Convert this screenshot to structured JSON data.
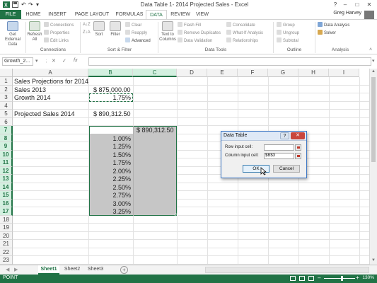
{
  "titlebar": {
    "title": "Data Table 1- 2014 Projected Sales - Excel",
    "help": "?",
    "minimize": "–",
    "restore": "□",
    "close": "✕"
  },
  "tabs": [
    "FILE",
    "HOME",
    "INSERT",
    "PAGE LAYOUT",
    "FORMULAS",
    "DATA",
    "REVIEW",
    "VIEW"
  ],
  "active_tab": "DATA",
  "user": "Greg Harvey",
  "ribbon": {
    "get_external": "Get External Data",
    "refresh_all": "Refresh All",
    "connections": "Connections",
    "properties": "Properties",
    "edit_links": "Edit Links",
    "sort": "Sort",
    "filter": "Filter",
    "clear": "Clear",
    "reapply": "Reapply",
    "advanced": "Advanced",
    "text_to_columns": "Text to Columns",
    "flash_fill": "Flash Fill",
    "remove_duplicates": "Remove Duplicates",
    "data_validation": "Data Validation",
    "consolidate": "Consolidate",
    "what_if": "What-If Analysis",
    "relationships": "Relationships",
    "group": "Group",
    "ungroup": "Ungroup",
    "subtotal": "Subtotal",
    "data_analysis": "Data Analysis",
    "solver": "Solver",
    "groups": [
      "Connections",
      "Sort & Filter",
      "Data Tools",
      "Outline",
      "Analysis"
    ]
  },
  "formula_bar": {
    "name_box": "Growth_2...",
    "cancel": "✕",
    "enter": "✓",
    "fx": "fx",
    "value": ""
  },
  "columns": [
    "A",
    "B",
    "C",
    "D",
    "E",
    "F",
    "G",
    "H",
    "I"
  ],
  "selected_columns": [
    "B",
    "C"
  ],
  "rows": [
    "1",
    "2",
    "3",
    "4",
    "5",
    "6",
    "7",
    "8",
    "9",
    "10",
    "11",
    "12",
    "13",
    "14",
    "15",
    "16",
    "17",
    "18",
    "19",
    "20",
    "21",
    "22",
    "23"
  ],
  "selected_rows": [
    "7",
    "8",
    "9",
    "10",
    "11",
    "12",
    "13",
    "14",
    "15",
    "16",
    "17"
  ],
  "cells": {
    "A1": "Sales Projections for 2014",
    "A2": "Sales 2013",
    "B2": "$ 875,000.00",
    "A3": "Growth 2014",
    "B3": "1.75%",
    "A5": "Projected Sales 2014",
    "B5": "$ 890,312.50",
    "C7": "$ 890,312.50",
    "B8_to_B17": [
      "1.00%",
      "1.25%",
      "1.50%",
      "1.75%",
      "2.00%",
      "2.25%",
      "2.50%",
      "2.75%",
      "3.00%",
      "3.25%"
    ]
  },
  "dialog": {
    "title": "Data Table",
    "help": "?",
    "close": "✕",
    "row_input_label": "Row input cell:",
    "row_input_value": "",
    "col_input_label": "Column input cell:",
    "col_input_value": "$B$3",
    "ok": "OK",
    "cancel": "Cancel"
  },
  "sheets": [
    "Sheet1",
    "Sheet2",
    "Sheet3"
  ],
  "active_sheet": "Sheet1",
  "add_sheet": "+",
  "status": {
    "mode": "POINT",
    "zoom": "130%"
  },
  "colors": {
    "accent": "#217346",
    "selection": "#c6c6c6"
  }
}
